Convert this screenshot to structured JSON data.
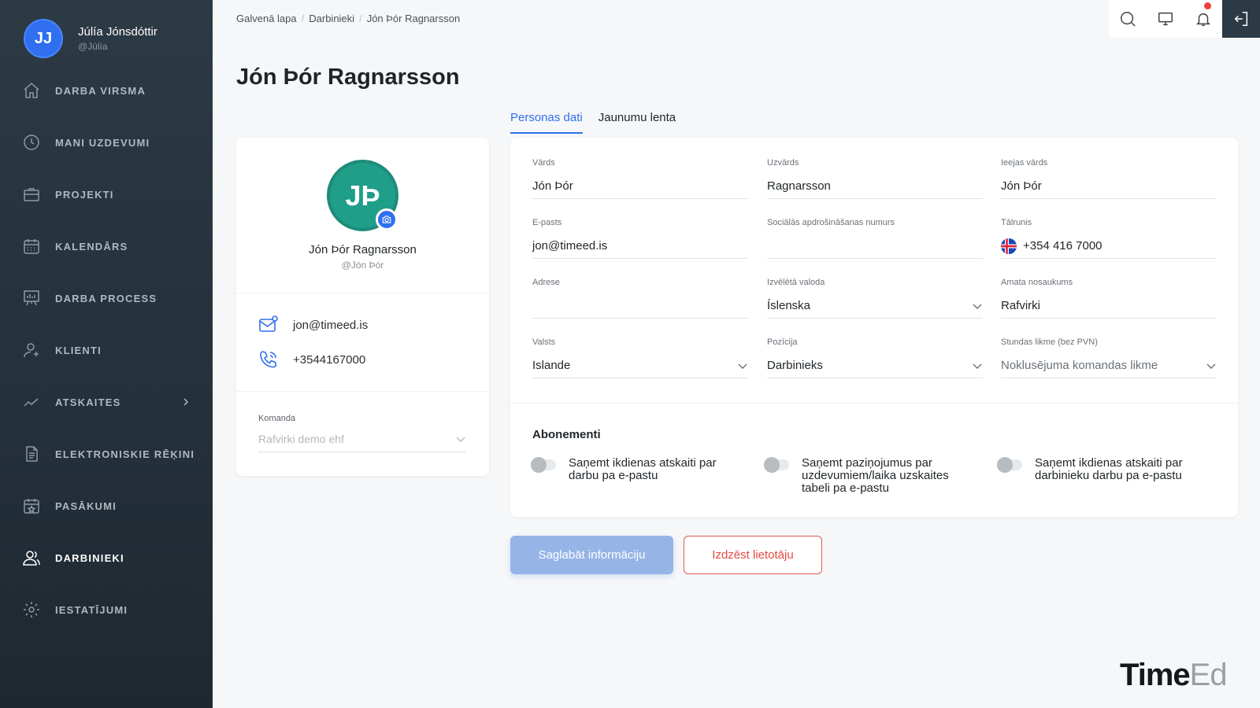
{
  "user": {
    "initials": "JJ",
    "name": "Júlía Jónsdóttir",
    "handle": "@Júlía"
  },
  "nav": [
    {
      "label": "DARBA VIRSMA",
      "icon": "home-icon"
    },
    {
      "label": "MANI UZDEVUMI",
      "icon": "clock-icon"
    },
    {
      "label": "PROJEKTI",
      "icon": "briefcase-icon"
    },
    {
      "label": "KALENDĀRS",
      "icon": "calendar-icon"
    },
    {
      "label": "DARBA PROCESS",
      "icon": "board-icon"
    },
    {
      "label": "KLIENTI",
      "icon": "client-icon"
    },
    {
      "label": "ATSKAITES",
      "icon": "chart-icon"
    },
    {
      "label": "ELEKTRONISKIE RĒĶINI",
      "icon": "invoice-icon"
    },
    {
      "label": "PASĀKUMI",
      "icon": "event-icon"
    },
    {
      "label": "DARBINIEKI",
      "icon": "users-icon",
      "active": true
    },
    {
      "label": "IESTATĪJUMI",
      "icon": "gear-icon"
    }
  ],
  "breadcrumb": {
    "home": "Galvenā lapa",
    "section": "Darbinieki",
    "current": "Jón Þór Ragnarsson"
  },
  "page_title": "Jón Þór Ragnarsson",
  "profile": {
    "initials": "JÞ",
    "name": "Jón Þór Ragnarsson",
    "handle": "@Jón Þór",
    "email": "jon@timeed.is",
    "phone": "+3544167000",
    "team_label": "Komanda",
    "team_value": "Rafvirki demo ehf"
  },
  "tabs": {
    "personal": "Personas dati",
    "feed": "Jaunumu lenta"
  },
  "form": {
    "first_name": {
      "label": "Vārds",
      "value": "Jón Þór"
    },
    "last_name": {
      "label": "Uzvārds",
      "value": "Ragnarsson"
    },
    "username": {
      "label": "Ieejas vārds",
      "value": "Jón Þór"
    },
    "email": {
      "label": "E-pasts",
      "value": "jon@timeed.is"
    },
    "ssn": {
      "label": "Sociālās apdrošināšanas numurs",
      "value": ""
    },
    "phone": {
      "label": "Tālrunis",
      "value": "+354 416 7000"
    },
    "address": {
      "label": "Adrese",
      "value": ""
    },
    "language": {
      "label": "Izvēlētā valoda",
      "value": "Íslenska"
    },
    "job_title": {
      "label": "Amata nosaukums",
      "value": "Rafvirki"
    },
    "country": {
      "label": "Valsts",
      "value": "Islande"
    },
    "position": {
      "label": "Pozīcija",
      "value": "Darbinieks"
    },
    "hourly_rate": {
      "label": "Stundas likme (bez PVN)",
      "value": "Noklusējuma komandas likme"
    }
  },
  "subscriptions": {
    "title": "Abonementi",
    "items": [
      "Saņemt ikdienas atskaiti par darbu pa e-pastu",
      "Saņemt paziņojumus par uzdevumiem/laika uzskaites tabeli pa e-pastu",
      "Saņemt ikdienas atskaiti par darbinieku darbu pa e-pastu"
    ]
  },
  "buttons": {
    "save": "Saglabāt informāciju",
    "delete": "Izdzēst lietotāju"
  },
  "logo": {
    "bold": "Time",
    "light": "Ed"
  },
  "colors": {
    "accent": "#2f6ff0",
    "sidebar": "#2c3a45",
    "avatar_green": "#1f9e8a",
    "danger": "#e04a3f"
  }
}
